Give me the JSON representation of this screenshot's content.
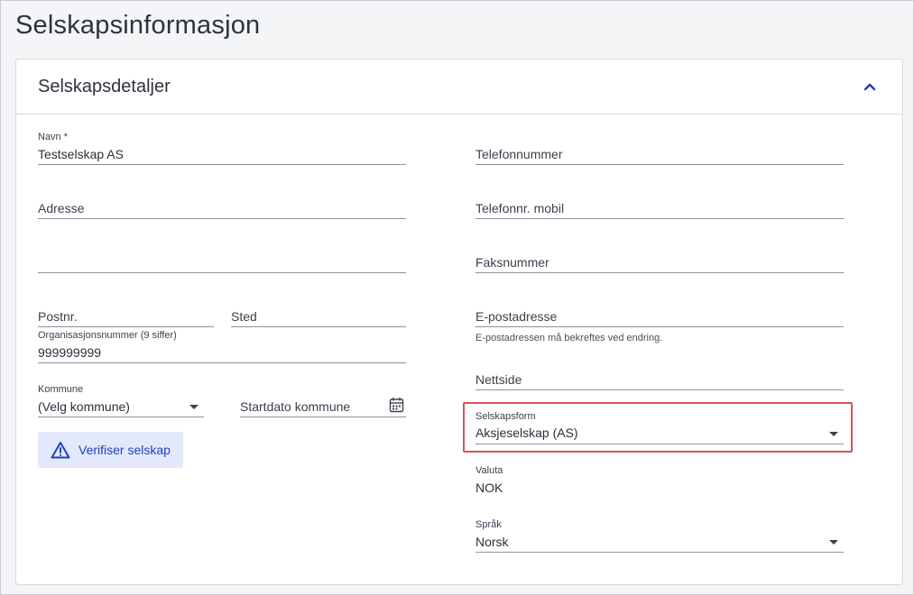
{
  "page": {
    "title": "Selskapsinformasjon"
  },
  "card": {
    "title": "Selskapsdetaljer",
    "collapse_icon": "chevron-up-icon"
  },
  "left": {
    "navn": {
      "label": "Navn *",
      "value": "Testselskap AS"
    },
    "adresse": {
      "placeholder": "Adresse"
    },
    "adresse2": {
      "value": ""
    },
    "postnr": {
      "placeholder": "Postnr."
    },
    "sted": {
      "placeholder": "Sted"
    },
    "orgnr": {
      "label": "Organisasjonsnummer (9 siffer)",
      "value": "999999999"
    },
    "kommune": {
      "label": "Kommune",
      "value": "(Velg kommune)"
    },
    "startdato": {
      "placeholder": "Startdato kommune",
      "icon": "calendar-icon"
    },
    "verify_button": {
      "label": "Verifiser selskap",
      "icon": "warning-triangle-icon"
    }
  },
  "right": {
    "telefon": {
      "placeholder": "Telefonnummer"
    },
    "mobil": {
      "placeholder": "Telefonnr. mobil"
    },
    "faks": {
      "placeholder": "Faksnummer"
    },
    "epost": {
      "placeholder": "E-postadresse",
      "helper": "E-postadressen må bekreftes ved endring."
    },
    "nettside": {
      "placeholder": "Nettside"
    },
    "selskapsform": {
      "label": "Selskapsform",
      "value": "Aksjeselskap (AS)"
    },
    "valuta": {
      "label": "Valuta",
      "value": "NOK"
    },
    "sprak": {
      "label": "Språk",
      "value": "Norsk"
    }
  },
  "colors": {
    "accent": "#1f3fc0",
    "highlight": "#d9505e",
    "button_bg": "#e3e9fb"
  }
}
